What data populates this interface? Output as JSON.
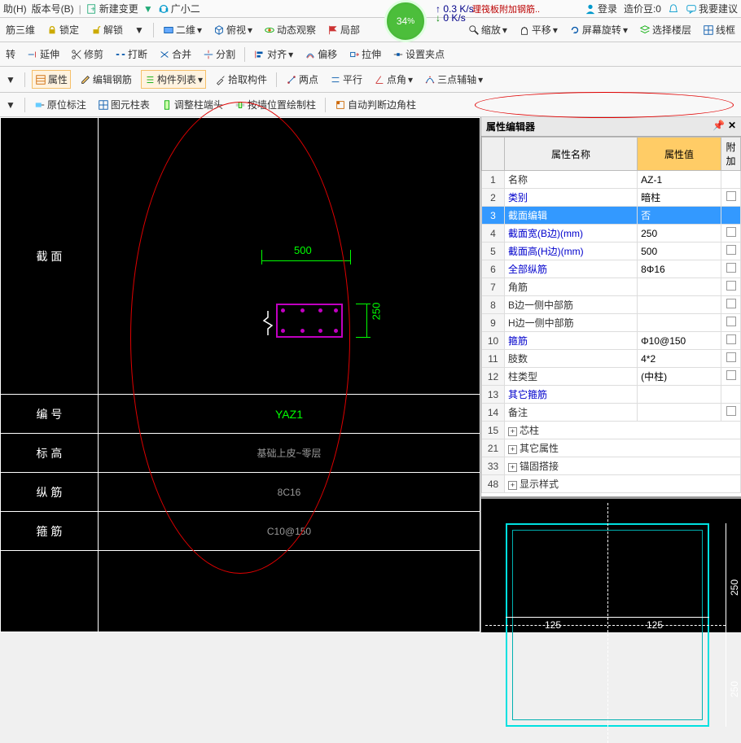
{
  "menu": {
    "help": "助(H)",
    "version": "版本号(B)",
    "newChange": "新建变更",
    "guangxiaoer": "广小二"
  },
  "toprightLinks": {
    "login": "登录",
    "cost": "造价豆:0",
    "msg": "",
    "suggest": "我要建议"
  },
  "speed": {
    "up": "0.3 K/s",
    "down": "0 K/s",
    "pct": "34"
  },
  "filetab": "理筏板附加钢筋..",
  "ribbon1": {
    "rebar3d": "筋三维",
    "lock": "锁定",
    "unlock": "解锁",
    "twod": "二维",
    "elevation": "俯视",
    "dynObs": "动态观察",
    "local": "局部",
    "zoom": "缩放",
    "pan": "平移",
    "screenRot": "屏幕旋转",
    "selectFloor": "选择楼层",
    "wireframe": "线框"
  },
  "ribbon2": {
    "rotate": "转",
    "extend": "延伸",
    "trim": "修剪",
    "break": "打断",
    "merge": "合并",
    "split": "分割",
    "align": "对齐",
    "offset": "偏移",
    "stretch": "拉伸",
    "setGrip": "设置夹点"
  },
  "ribbon3": {
    "attribute": "属性",
    "editRebar": "编辑钢筋",
    "compList": "构件列表",
    "pick": "拾取构件",
    "twoPt": "两点",
    "parallel": "平行",
    "ptAngle": "点角",
    "threeAux": "三点辅轴"
  },
  "ribbon4": {
    "origLabel": "原位标注",
    "tupleTable": "图元柱表",
    "adjColEnd": "调整柱端头",
    "drawByWall": "按墙位置绘制柱",
    "autoEdgeCol": "自动判断边角柱"
  },
  "cadTable": {
    "section": "截 面",
    "number": "编 号",
    "numberVal": "YAZ1",
    "elev": "标 高",
    "elevVal": "基础上皮~零层",
    "longRebar": "纵 筋",
    "longRebarVal": "8C16",
    "stirrup": "箍 筋",
    "stirrupVal": "C10@150",
    "dimW": "500",
    "dimH": "250"
  },
  "propEditor": {
    "title": "属性编辑器",
    "cols": {
      "name": "属性名称",
      "value": "属性值",
      "attach": "附加"
    },
    "rows": [
      {
        "n": "1",
        "name": "名称",
        "val": "AZ-1",
        "blue": false,
        "cb": false
      },
      {
        "n": "2",
        "name": "类别",
        "val": "暗柱",
        "blue": true,
        "cb": true
      },
      {
        "n": "3",
        "name": "截面编辑",
        "val": "否",
        "blue": true,
        "cb": false,
        "selected": true
      },
      {
        "n": "4",
        "name": "截面宽(B边)(mm)",
        "val": "250",
        "blue": true,
        "cb": true
      },
      {
        "n": "5",
        "name": "截面高(H边)(mm)",
        "val": "500",
        "blue": true,
        "cb": true
      },
      {
        "n": "6",
        "name": "全部纵筋",
        "val": "8Φ16",
        "blue": true,
        "cb": true
      },
      {
        "n": "7",
        "name": "角筋",
        "val": "",
        "blue": false,
        "cb": true
      },
      {
        "n": "8",
        "name": "B边一侧中部筋",
        "val": "",
        "blue": false,
        "cb": true
      },
      {
        "n": "9",
        "name": "H边一侧中部筋",
        "val": "",
        "blue": false,
        "cb": true
      },
      {
        "n": "10",
        "name": "箍筋",
        "val": "Φ10@150",
        "blue": true,
        "cb": true
      },
      {
        "n": "11",
        "name": "肢数",
        "val": "4*2",
        "blue": false,
        "cb": true
      },
      {
        "n": "12",
        "name": "柱类型",
        "val": "(中柱)",
        "blue": false,
        "cb": true
      },
      {
        "n": "13",
        "name": "其它箍筋",
        "val": "",
        "blue": true,
        "cb": false
      },
      {
        "n": "14",
        "name": "备注",
        "val": "",
        "blue": false,
        "cb": true
      }
    ],
    "groups": [
      {
        "n": "15",
        "label": "芯柱"
      },
      {
        "n": "21",
        "label": "其它属性"
      },
      {
        "n": "33",
        "label": "锚固搭接"
      },
      {
        "n": "48",
        "label": "显示样式"
      }
    ]
  },
  "preview": {
    "d1": "250",
    "d2": "250",
    "d3": "125",
    "d4": "125"
  }
}
